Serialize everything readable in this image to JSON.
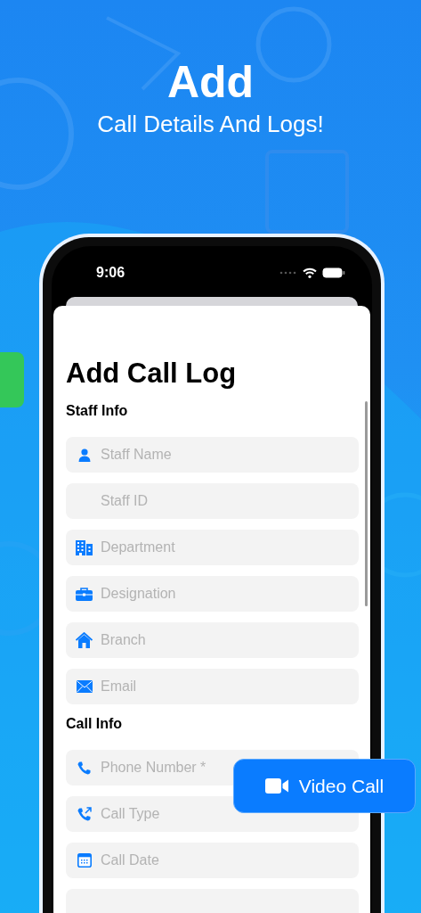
{
  "header": {
    "title": "Add",
    "subtitle": "Call Details And Logs!"
  },
  "status_bar": {
    "time": "9:06"
  },
  "form": {
    "title": "Add Call Log",
    "sections": [
      {
        "heading": "Staff Info",
        "fields": [
          {
            "placeholder": "Staff Name"
          },
          {
            "placeholder": "Staff ID"
          },
          {
            "placeholder": "Department"
          },
          {
            "placeholder": "Designation"
          },
          {
            "placeholder": "Branch"
          },
          {
            "placeholder": "Email"
          }
        ]
      },
      {
        "heading": "Call Info",
        "fields": [
          {
            "placeholder": "Phone Number *"
          },
          {
            "placeholder": "Call Type"
          },
          {
            "placeholder": "Call Date"
          }
        ]
      }
    ]
  },
  "floating_button": {
    "label": "Video Call"
  }
}
